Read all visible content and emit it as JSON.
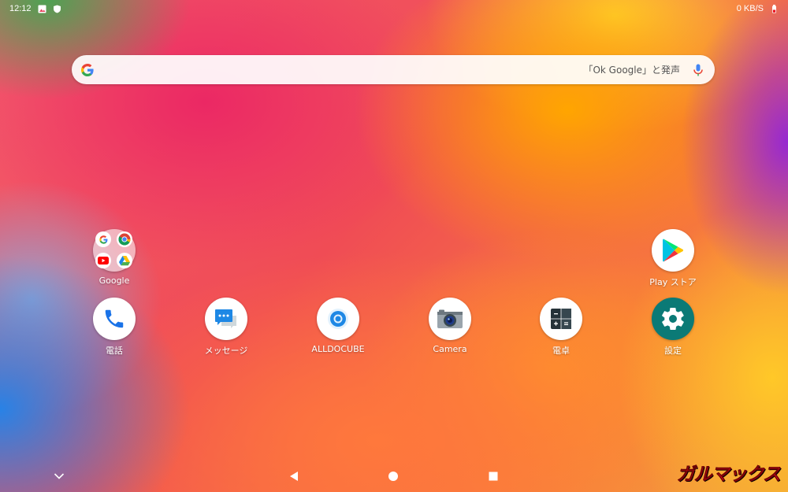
{
  "status_bar": {
    "time": "12:12",
    "network_speed": "0 KB/S",
    "icons": [
      "image-icon",
      "shield-icon",
      "battery-icon"
    ]
  },
  "search": {
    "hint": "「Ok Google」と発声",
    "icons": [
      "google-g-icon",
      "microphone-icon"
    ]
  },
  "apps": {
    "google_folder": {
      "label": "Google",
      "icon": "google-folder-icon"
    },
    "play_store": {
      "label": "Play ストア",
      "icon": "play-store-icon"
    },
    "phone": {
      "label": "電話",
      "icon": "phone-icon"
    },
    "messages": {
      "label": "メッセージ",
      "icon": "messages-icon"
    },
    "alldocube": {
      "label": "ALLDOCUBE",
      "icon": "alldocube-icon"
    },
    "camera": {
      "label": "Camera",
      "icon": "camera-icon"
    },
    "calculator": {
      "label": "電卓",
      "icon": "calculator-icon"
    },
    "settings": {
      "label": "設定",
      "icon": "settings-icon"
    }
  },
  "nav_bar": {
    "icons": [
      "chevron-down-icon",
      "back-icon",
      "home-icon",
      "recents-icon"
    ]
  },
  "watermark": {
    "text": "ガルマックス"
  },
  "colors": {
    "phone_blue": "#1a73e8",
    "settings_teal": "#0b7a76",
    "watermark_red": "#e8101e"
  }
}
